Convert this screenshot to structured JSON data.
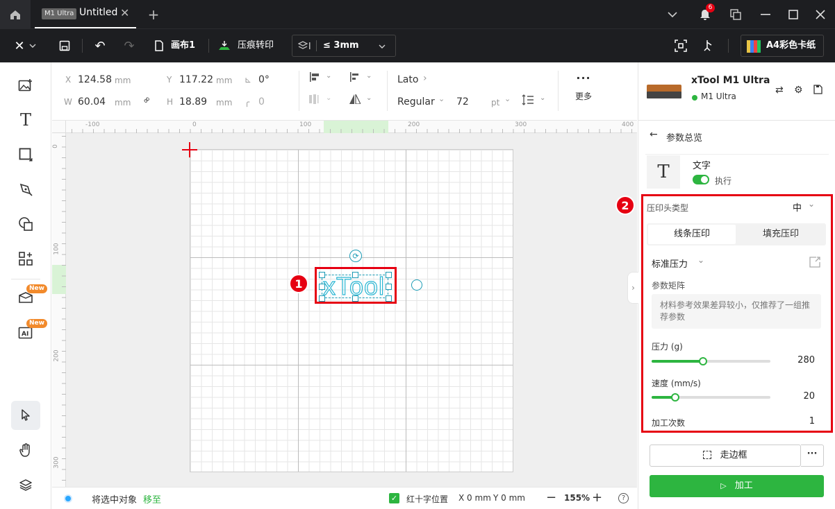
{
  "titlebar": {
    "device_tag": "M1 Ultra",
    "tab_title": "Untitled",
    "notification_count": "6"
  },
  "toolbar": {
    "canvas_label": "画布1",
    "process_label": "压痕转印",
    "thickness_label": "≤ 3mm",
    "material_label": "A4彩色卡纸"
  },
  "leftbar": {
    "new_badge_1": "New",
    "new_badge_2": "New"
  },
  "properties": {
    "x_label": "X",
    "x_value": "124.58",
    "x_unit": "mm",
    "y_label": "Y",
    "y_value": "117.22",
    "y_unit": "mm",
    "angle_value": "0°",
    "w_label": "W",
    "w_value": "60.04",
    "w_unit": "mm",
    "h_label": "H",
    "h_value": "18.89",
    "h_unit": "mm",
    "radius_value": "0",
    "font_family": "Lato",
    "font_style": "Regular",
    "font_size": "72",
    "font_unit": "pt",
    "more_label": "更多"
  },
  "ruler": {
    "top_ticks": [
      "-100",
      "0",
      "100",
      "200",
      "300",
      "400"
    ],
    "left_ticks": [
      "0",
      "100",
      "200",
      "300"
    ]
  },
  "canvas": {
    "text_object": "xTool",
    "annotation_1": "1",
    "annotation_2": "2"
  },
  "statusbar": {
    "move_prefix": "将选中对象",
    "move_link": "移至",
    "crosshair_label": "红十字位置",
    "x_pos": "X 0 mm",
    "y_pos": "Y 0 mm",
    "zoom": "155%"
  },
  "device": {
    "name": "xTool M1 Ultra",
    "model": "M1 Ultra"
  },
  "params": {
    "back_label": "参数总览",
    "layer_name": "文字",
    "execute_label": "执行",
    "head_type_label": "压印头类型",
    "head_type_value": "中",
    "tab_line": "线条压印",
    "tab_fill": "填充压印",
    "preset": "标准压力",
    "matrix_label": "参数矩阵",
    "matrix_note": "材料参考效果差异较小，仅推荐了一组推荐参数",
    "pressure_label": "压力 (g)",
    "pressure_value": "280",
    "pressure_fraction": 0.43,
    "speed_label": "速度 (mm/s)",
    "speed_value": "20",
    "speed_fraction": 0.2,
    "passes_label": "加工次数",
    "passes_value": "1",
    "frame_button": "走边框",
    "process_button": "加工"
  },
  "colors": {
    "accent_green": "#2db540",
    "annotation_red": "#e60012",
    "dark_bar": "#1d1e21"
  }
}
